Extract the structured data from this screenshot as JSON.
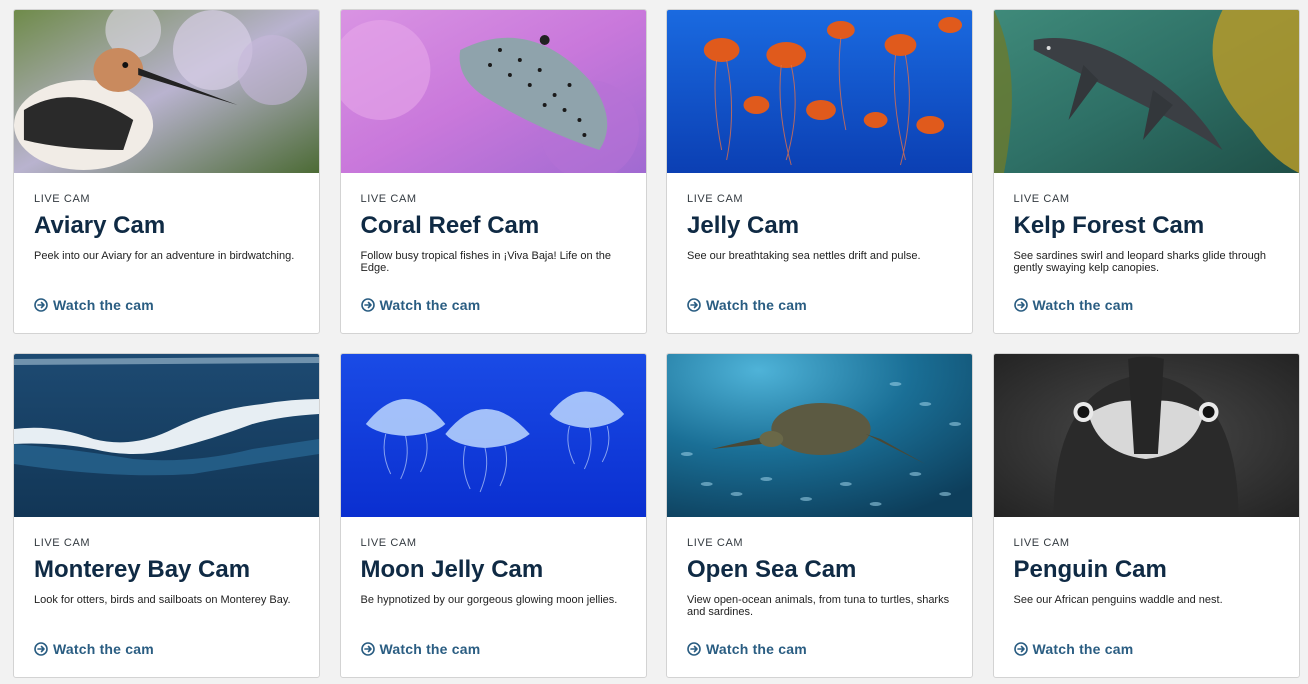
{
  "cams": [
    {
      "eyebrow": "LIVE CAM",
      "title": "Aviary Cam",
      "description": "Peek into our Aviary for an adventure in birdwatching.",
      "cta": "Watch the cam",
      "image": "avocet-bird-photo"
    },
    {
      "eyebrow": "LIVE CAM",
      "title": "Coral Reef Cam",
      "description": "Follow busy tropical fishes in ¡Viva Baja! Life on the Edge.",
      "cta": "Watch the cam",
      "image": "boxfish-photo"
    },
    {
      "eyebrow": "LIVE CAM",
      "title": "Jelly Cam",
      "description": "See our breathtaking sea nettles drift and pulse.",
      "cta": "Watch the cam",
      "image": "sea-nettles-photo"
    },
    {
      "eyebrow": "LIVE CAM",
      "title": "Kelp Forest Cam",
      "description": "See sardines swirl and leopard sharks glide through gently swaying kelp canopies.",
      "cta": "Watch the cam",
      "image": "leopard-shark-kelp-photo"
    },
    {
      "eyebrow": "LIVE CAM",
      "title": "Monterey Bay Cam",
      "description": "Look for otters, birds and sailboats on Monterey Bay.",
      "cta": "Watch the cam",
      "image": "ocean-waves-photo"
    },
    {
      "eyebrow": "LIVE CAM",
      "title": "Moon Jelly Cam",
      "description": "Be hypnotized by our gorgeous glowing moon jellies.",
      "cta": "Watch the cam",
      "image": "moon-jellies-photo"
    },
    {
      "eyebrow": "LIVE CAM",
      "title": "Open Sea Cam",
      "description": "View open-ocean animals, from tuna to turtles, sharks and sardines.",
      "cta": "Watch the cam",
      "image": "sea-turtle-photo"
    },
    {
      "eyebrow": "LIVE CAM",
      "title": "Penguin Cam",
      "description": "See our African penguins waddle and nest.",
      "cta": "Watch the cam",
      "image": "penguin-photo"
    }
  ],
  "colors": {
    "title": "#0f2a44",
    "cta": "#2a5d82",
    "page_background": "#f2f2f2"
  }
}
